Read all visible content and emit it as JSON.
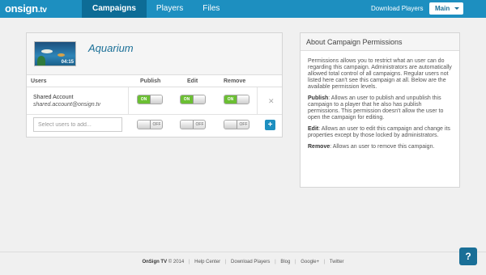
{
  "brand": {
    "name": "onsign",
    "suffix": ".tv"
  },
  "nav": {
    "items": [
      {
        "label": "Campaigns",
        "active": true
      },
      {
        "label": "Players",
        "active": false
      },
      {
        "label": "Files",
        "active": false
      }
    ],
    "download_label": "Download Players",
    "main_label": "Main"
  },
  "campaign": {
    "title": "Aquarium",
    "thumbnail_time": "04:15",
    "columns": {
      "users": "Users",
      "publish": "Publish",
      "edit": "Edit",
      "remove": "Remove"
    },
    "account": {
      "name": "Shared Account",
      "email": "shared.account@onsign.tv",
      "publish": "ON",
      "edit": "ON",
      "remove": "ON"
    },
    "new_user": {
      "placeholder": "Select users to add...",
      "publish": "OFF",
      "edit": "OFF",
      "remove": "OFF"
    },
    "remove_symbol": "✕",
    "add_symbol": "+"
  },
  "about": {
    "title": "About Campaign Permissions",
    "intro": "Permissions allows you to restrict what an user can do regarding this campaign. Administrators are automatically allowed total control of all campaigns. Regular users not listed here can't see this campaign at all. Below are the available permission levels.",
    "publish_term": "Publish",
    "publish_desc": ": Allows an user to publish and unpublish this campaign to a player that he also has publish permissions. This permission doesn't allow the user to open the campaign for editing.",
    "edit_term": "Edit",
    "edit_desc": ": Allows an user to edit this campaign and change its properties except by those locked by administrators.",
    "remove_term": "Remove",
    "remove_desc": ": Allows an user to remove this campaign."
  },
  "footer": {
    "copyright": "OnSign TV",
    "year": "© 2014",
    "links": [
      "Help Center",
      "Download Players",
      "Blog",
      "Google+",
      "Twitter"
    ]
  },
  "help_symbol": "?",
  "colors": {
    "topbar": "#1d8fc0",
    "active_tab": "#0d6c96",
    "toggle_on": "#6bbf33",
    "title": "#1a6f97"
  }
}
